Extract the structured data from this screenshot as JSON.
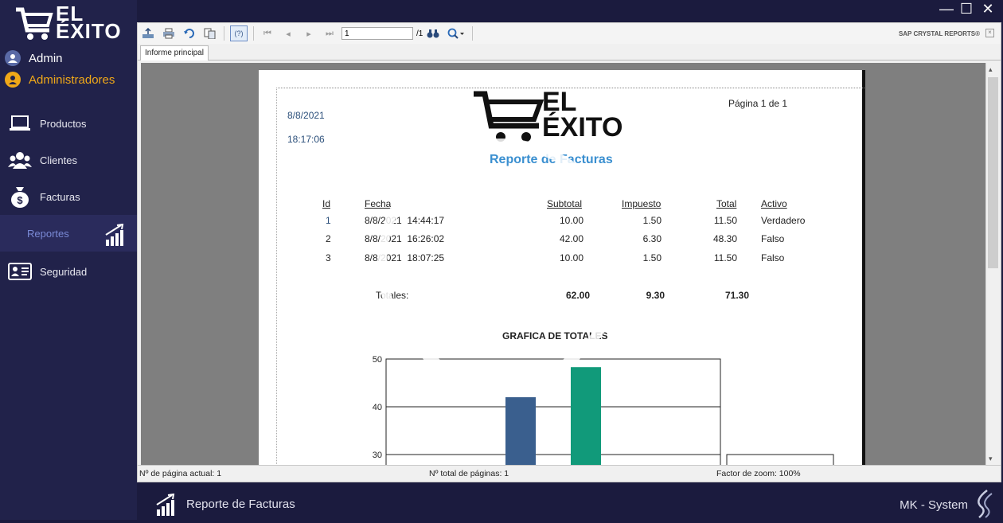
{
  "app": {
    "logo_line1": "EL",
    "logo_line2": "ÉXITO",
    "user_name": "Admin",
    "user_role": "Administradores"
  },
  "sidebar": {
    "items": [
      {
        "label": "Productos",
        "icon": "laptop-icon"
      },
      {
        "label": "Clientes",
        "icon": "users-icon"
      },
      {
        "label": "Facturas",
        "icon": "money-bag-icon"
      },
      {
        "label": "Reportes",
        "icon": "chart-icon",
        "active": true
      },
      {
        "label": "Seguridad",
        "icon": "id-card-icon"
      }
    ]
  },
  "window": {
    "minimize": "—",
    "maximize": "☐",
    "close": "✕"
  },
  "viewer": {
    "page_input": "1",
    "page_total": "/1",
    "brand": "SAP CRYSTAL REPORTS®",
    "tab": "Informe principal",
    "status": {
      "current_page": "Nº de página actual: 1",
      "total_pages": "Nº total de páginas: 1",
      "zoom": "Factor de zoom: 100%"
    }
  },
  "report": {
    "date": "8/8/2021",
    "time": "18:17:06",
    "page_label": "Página 1 de 1",
    "logo_line1": "EL",
    "logo_line2": "ÉXITO",
    "title": "Reporte de Facturas",
    "columns": [
      "Id",
      "Fecha",
      "Subtotal",
      "Impuesto",
      "Total",
      "Activo"
    ],
    "rows": [
      {
        "id": "1",
        "fecha": "8/8/2021  14:44:17",
        "subtotal": "10.00",
        "impuesto": "1.50",
        "total": "11.50",
        "activo": "Verdadero"
      },
      {
        "id": "2",
        "fecha": "8/8/2021  16:26:02",
        "subtotal": "42.00",
        "impuesto": "6.30",
        "total": "48.30",
        "activo": "Falso"
      },
      {
        "id": "3",
        "fecha": "8/8/2021  18:07:25",
        "subtotal": "10.00",
        "impuesto": "1.50",
        "total": "11.50",
        "activo": "Falso"
      }
    ],
    "totals_label": "Totales:",
    "totals": {
      "subtotal": "62.00",
      "impuesto": "9.30",
      "total": "71.30"
    },
    "chart_title": "GRAFICA DE TOTALES"
  },
  "chart_data": {
    "type": "bar",
    "title": "GRAFICA DE TOTALES",
    "yticks": [
      30,
      40,
      50
    ],
    "ylim": [
      30,
      50
    ],
    "bars": [
      {
        "value": 42,
        "color": "#3a5f8e"
      },
      {
        "value": 48.3,
        "color": "#119a7a"
      }
    ]
  },
  "footer": {
    "title": "Reporte de Facturas",
    "brand": "MK - System"
  }
}
